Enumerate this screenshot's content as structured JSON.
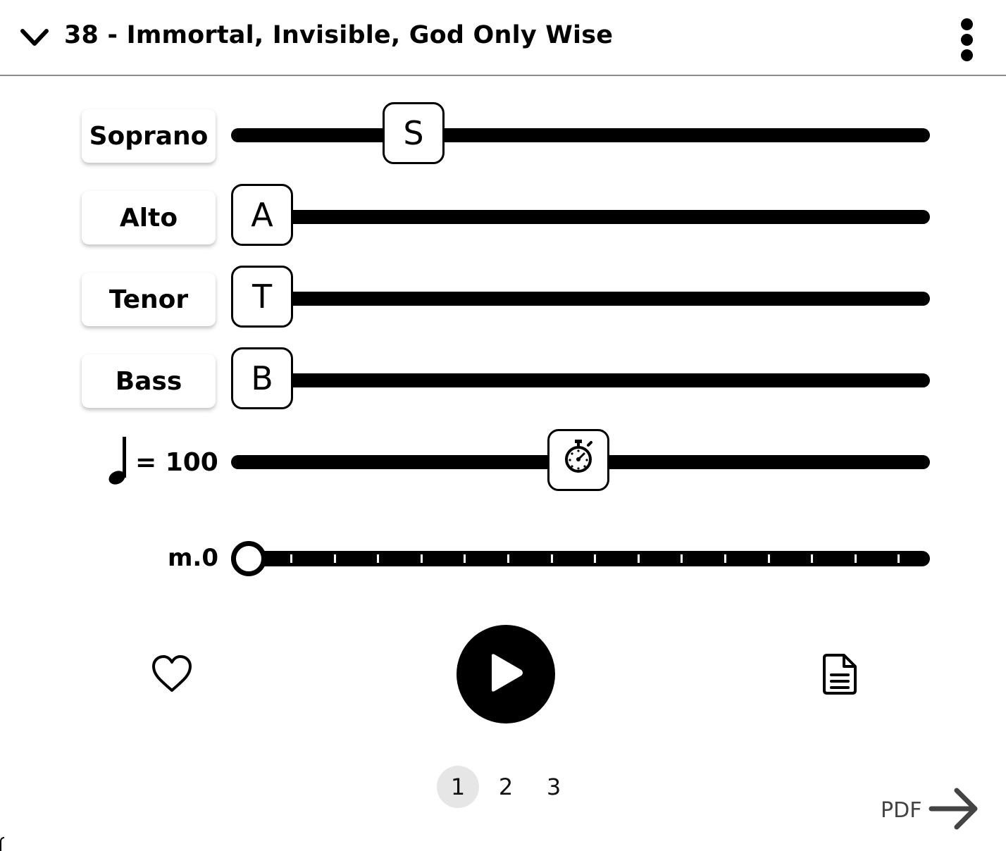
{
  "header": {
    "title": "38 - Immortal, Invisible, God Only Wise",
    "collapse_icon": "chevron-down-icon",
    "menu_icon": "more-vertical-icon"
  },
  "voices": [
    {
      "label": "Soprano",
      "thumb": "S",
      "level": 0.26
    },
    {
      "label": "Alto",
      "thumb": "A",
      "level": 0.0
    },
    {
      "label": "Tenor",
      "thumb": "T",
      "level": 0.0
    },
    {
      "label": "Bass",
      "thumb": "B",
      "level": 0.0
    }
  ],
  "tempo": {
    "label": "= 100",
    "note_icon": "quarter-note-icon",
    "thumb_icon": "stopwatch-icon",
    "level": 0.5
  },
  "measure": {
    "label": "m.0",
    "position": 0
  },
  "controls": {
    "favorite_icon": "heart-icon",
    "play_icon": "play-icon",
    "lyrics_icon": "document-icon"
  },
  "pages": {
    "items": [
      "1",
      "2",
      "3"
    ],
    "active": "1"
  },
  "pdf": {
    "label": "PDF",
    "icon": "arrow-right-icon"
  }
}
